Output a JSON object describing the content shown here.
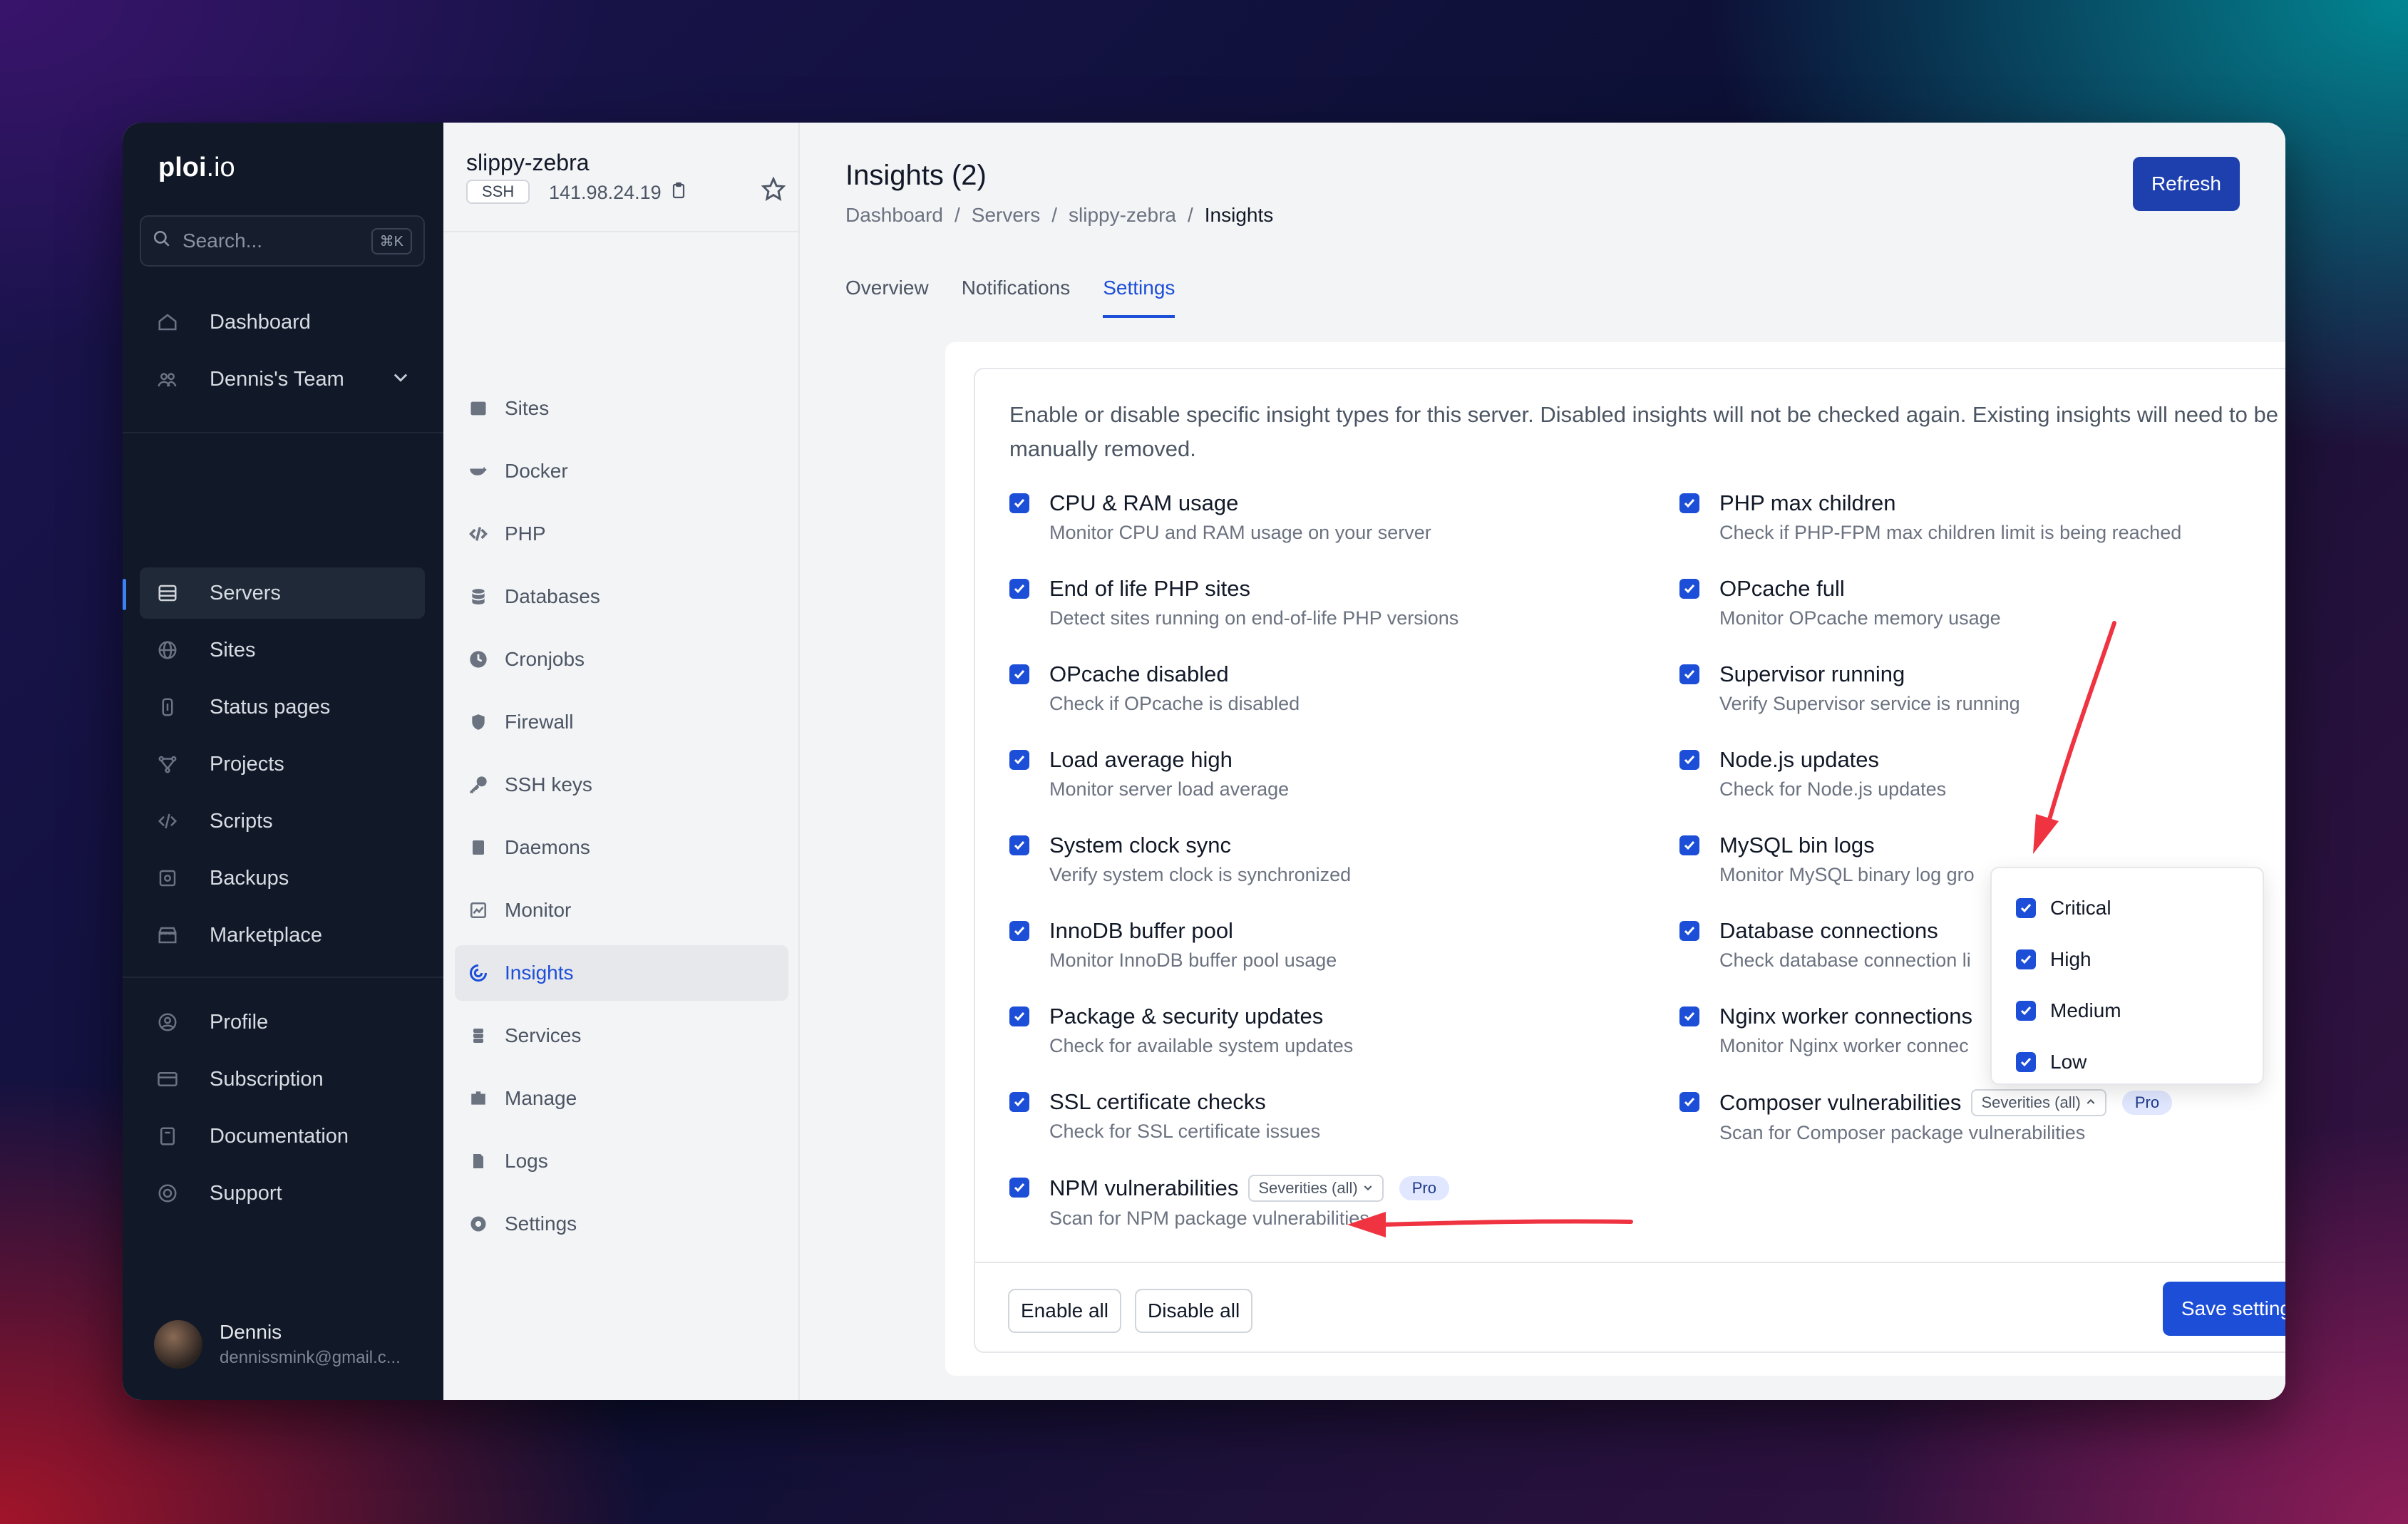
{
  "app": {
    "logo_bold": "ploi",
    "logo_rest": ".io"
  },
  "search": {
    "placeholder": "Search...",
    "shortcut": "⌘K"
  },
  "sidebar": {
    "items": [
      {
        "label": "Dashboard",
        "icon": "home-icon"
      },
      {
        "label": "Dennis's Team",
        "icon": "team-icon"
      },
      {
        "label": "Servers",
        "icon": "server-icon"
      },
      {
        "label": "Sites",
        "icon": "globe-icon"
      },
      {
        "label": "Status pages",
        "icon": "status-icon"
      },
      {
        "label": "Projects",
        "icon": "projects-icon"
      },
      {
        "label": "Scripts",
        "icon": "code-icon"
      },
      {
        "label": "Backups",
        "icon": "backup-icon"
      },
      {
        "label": "Marketplace",
        "icon": "store-icon"
      },
      {
        "label": "Profile",
        "icon": "user-icon"
      },
      {
        "label": "Subscription",
        "icon": "card-icon"
      },
      {
        "label": "Documentation",
        "icon": "book-icon"
      },
      {
        "label": "Support",
        "icon": "lifebuoy-icon"
      }
    ],
    "user": {
      "name": "Dennis",
      "email": "dennissmink@gmail.c..."
    }
  },
  "server": {
    "name": "slippy-zebra",
    "badge": "SSH",
    "ip": "141.98.24.19"
  },
  "subnav": {
    "items": [
      {
        "label": "Sites"
      },
      {
        "label": "Docker"
      },
      {
        "label": "PHP"
      },
      {
        "label": "Databases"
      },
      {
        "label": "Cronjobs"
      },
      {
        "label": "Firewall"
      },
      {
        "label": "SSH keys"
      },
      {
        "label": "Daemons"
      },
      {
        "label": "Monitor"
      },
      {
        "label": "Insights"
      },
      {
        "label": "Services"
      },
      {
        "label": "Manage"
      },
      {
        "label": "Logs"
      },
      {
        "label": "Settings"
      }
    ]
  },
  "header": {
    "title": "Insights (2)",
    "breadcrumb": [
      "Dashboard",
      "/",
      "Servers",
      "/",
      "slippy-zebra",
      "/",
      "Insights"
    ],
    "refresh_label": "Refresh"
  },
  "tabs": [
    {
      "label": "Overview"
    },
    {
      "label": "Notifications"
    },
    {
      "label": "Settings"
    }
  ],
  "settings": {
    "intro": "Enable or disable specific insight types for this server. Disabled insights will not be checked again. Existing insights will need to be manually removed.",
    "left": [
      {
        "title": "CPU & RAM usage",
        "desc": "Monitor CPU and RAM usage on your server"
      },
      {
        "title": "End of life PHP sites",
        "desc": "Detect sites running on end-of-life PHP versions"
      },
      {
        "title": "OPcache disabled",
        "desc": "Check if OPcache is disabled"
      },
      {
        "title": "Load average high",
        "desc": "Monitor server load average"
      },
      {
        "title": "System clock sync",
        "desc": "Verify system clock is synchronized"
      },
      {
        "title": "InnoDB buffer pool",
        "desc": "Monitor InnoDB buffer pool usage"
      },
      {
        "title": "Package & security updates",
        "desc": "Check for available system updates"
      },
      {
        "title": "SSL certificate checks",
        "desc": "Check for SSL certificate issues"
      },
      {
        "title": "NPM vulnerabilities",
        "desc": "Scan for NPM package vulnerabilities",
        "severity": "Severities (all)",
        "badge": "Pro"
      }
    ],
    "right": [
      {
        "title": "PHP max children",
        "desc": "Check if PHP-FPM max children limit is being reached"
      },
      {
        "title": "OPcache full",
        "desc": "Monitor OPcache memory usage"
      },
      {
        "title": "Supervisor running",
        "desc": "Verify Supervisor service is running"
      },
      {
        "title": "Node.js updates",
        "desc": "Check for Node.js updates"
      },
      {
        "title": "MySQL bin logs",
        "desc": "Monitor MySQL binary log gro"
      },
      {
        "title": "Database connections",
        "desc": "Check database connection li"
      },
      {
        "title": "Nginx worker connections",
        "desc": "Monitor Nginx worker connec"
      },
      {
        "title": "Composer vulnerabilities",
        "desc": "Scan for Composer package vulnerabilities",
        "severity": "Severities (all)",
        "badge": "Pro"
      }
    ],
    "severity_options": [
      {
        "label": "Critical",
        "checked": true
      },
      {
        "label": "High",
        "checked": true
      },
      {
        "label": "Medium",
        "checked": true
      },
      {
        "label": "Low",
        "checked": true
      }
    ],
    "enable_all": "Enable all",
    "disable_all": "Disable all",
    "save": "Save settings"
  },
  "colors": {
    "accent": "#1d4ed8",
    "sidebar": "#111827",
    "annotation": "#ef3340"
  }
}
